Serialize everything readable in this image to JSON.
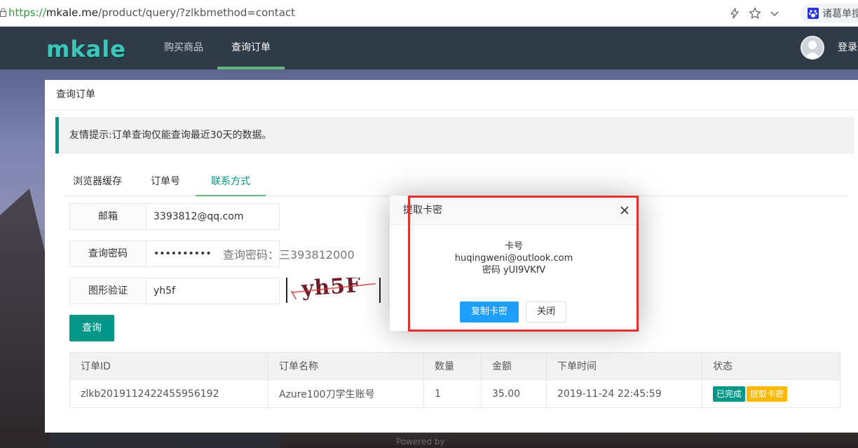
{
  "browser": {
    "url_scheme": "https://",
    "url_host": "mkale.me",
    "url_path": "/product/query/?zlkbmethod=contact",
    "search_label": "诸葛单搜"
  },
  "nav": {
    "logo": "mkale",
    "items": [
      "购买商品",
      "查询订单"
    ],
    "active_index": 1,
    "login": "登录"
  },
  "panel": {
    "title": "查询订单",
    "tip": "友情提示:订单查询仅能查询最近30天的数据。",
    "tabs": [
      "浏览器缓存",
      "订单号",
      "联系方式"
    ],
    "active_tab": 2,
    "form": {
      "email_label": "邮箱",
      "email_value": "3393812@qq.com",
      "password_label": "查询密码",
      "password_value": "••••••••••",
      "password_hint": "查询密码：三393812000",
      "captcha_label": "图形验证",
      "captcha_value": "yh5f",
      "captcha_image_text": "yh5F"
    },
    "query_button": "查询"
  },
  "table": {
    "headers": [
      "订单ID",
      "订单名称",
      "数量",
      "金额",
      "下单时间",
      "状态"
    ],
    "rows": [
      {
        "order_id": "zlkb2019112422455956192",
        "name": "Azure100刀学生账号",
        "qty": "1",
        "amount": "35.00",
        "time": "2019-11-24 22:45:59",
        "status": "已完成",
        "action": "提取卡密"
      }
    ]
  },
  "modal": {
    "title": "提取卡密",
    "card_label": "卡号",
    "card_value": "huqingweni@outlook.com",
    "secret_line": "密码 yUI9VKfV",
    "copy_button": "复制卡密",
    "close_button": "关闭"
  },
  "footer": {
    "powered": "Powered by"
  },
  "colors": {
    "nav_bg": "#2f3b47",
    "accent": "#009688",
    "tab_underline": "#5fb878",
    "primary_blue": "#1e9fff",
    "warning": "#ffb800",
    "highlight_red": "#e0322f"
  }
}
